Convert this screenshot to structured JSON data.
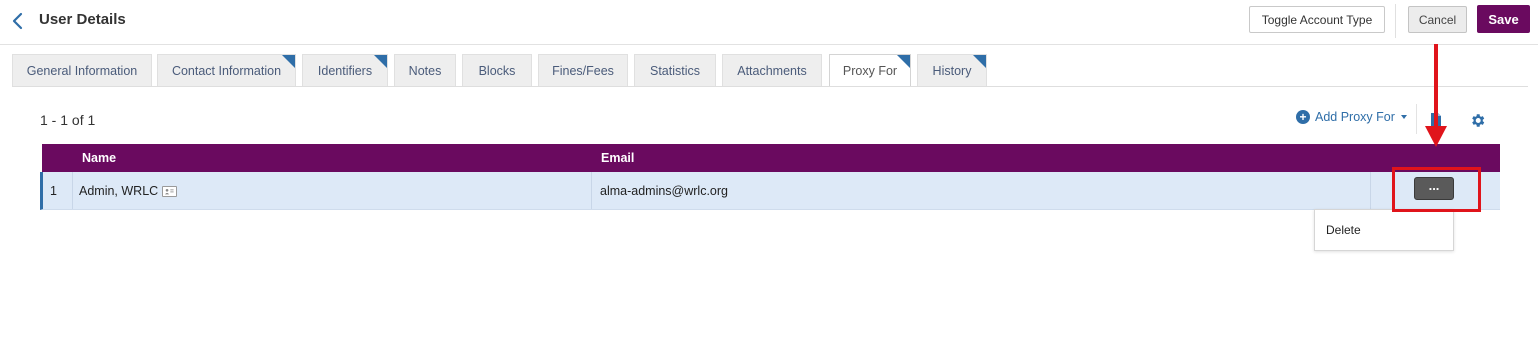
{
  "header": {
    "title": "User Details",
    "toggle_label": "Toggle Account Type",
    "cancel_label": "Cancel",
    "save_label": "Save"
  },
  "tabs": [
    {
      "label": "General Information",
      "active": false,
      "has_corner": false
    },
    {
      "label": "Contact Information",
      "active": false,
      "has_corner": true
    },
    {
      "label": "Identifiers",
      "active": false,
      "has_corner": true
    },
    {
      "label": "Notes",
      "active": false,
      "has_corner": false
    },
    {
      "label": "Blocks",
      "active": false,
      "has_corner": false
    },
    {
      "label": "Fines/Fees",
      "active": false,
      "has_corner": false
    },
    {
      "label": "Statistics",
      "active": false,
      "has_corner": false
    },
    {
      "label": "Attachments",
      "active": false,
      "has_corner": false
    },
    {
      "label": "Proxy For",
      "active": true,
      "has_corner": true
    },
    {
      "label": "History",
      "active": false,
      "has_corner": true
    }
  ],
  "toolbar": {
    "count": "1 - 1 of 1",
    "add_label": "Add Proxy For"
  },
  "table": {
    "columns": [
      "Name",
      "Email"
    ],
    "rows": [
      {
        "num": "1",
        "name": "Admin, WRLC",
        "email": "alma-admins@wrlc.org"
      }
    ]
  },
  "row_action": {
    "label": "...",
    "menu_items": [
      "Delete"
    ]
  },
  "colors": {
    "brand": "#6a0a5f",
    "link": "#2f6ea8",
    "selected_row": "#dde9f7",
    "annotation": "#e0141b"
  },
  "icons": [
    "chevron-left-icon",
    "plus-circle-icon",
    "caret-down-icon",
    "export-icon",
    "gear-icon",
    "contact-card-icon"
  ]
}
